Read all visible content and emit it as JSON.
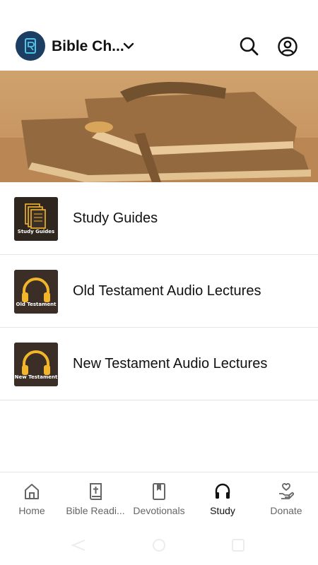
{
  "header": {
    "app_title": "Bible Ch..."
  },
  "list": {
    "items": [
      {
        "label": "Study Guides",
        "thumb_caption": "Study Guides",
        "thumb_icon": "books-icon"
      },
      {
        "label": "Old Testament Audio Lectures",
        "thumb_caption": "Old Testament",
        "thumb_icon": "headphones-icon"
      },
      {
        "label": "New Testament Audio Lectures",
        "thumb_caption": "New Testament",
        "thumb_icon": "headphones-icon"
      }
    ]
  },
  "nav": {
    "items": [
      {
        "label": "Home",
        "icon": "home-icon"
      },
      {
        "label": "Bible Readi...",
        "icon": "bible-icon"
      },
      {
        "label": "Devotionals",
        "icon": "bookmark-book-icon"
      },
      {
        "label": "Study",
        "icon": "headphones-icon",
        "active": true
      },
      {
        "label": "Donate",
        "icon": "donate-hand-icon"
      }
    ]
  },
  "colors": {
    "logo_bg": "#1c3e63",
    "hero_tint": "#d9a25a",
    "thumb_icon": "#f3b62a",
    "active_nav": "#111111",
    "inactive_nav": "#666666"
  }
}
